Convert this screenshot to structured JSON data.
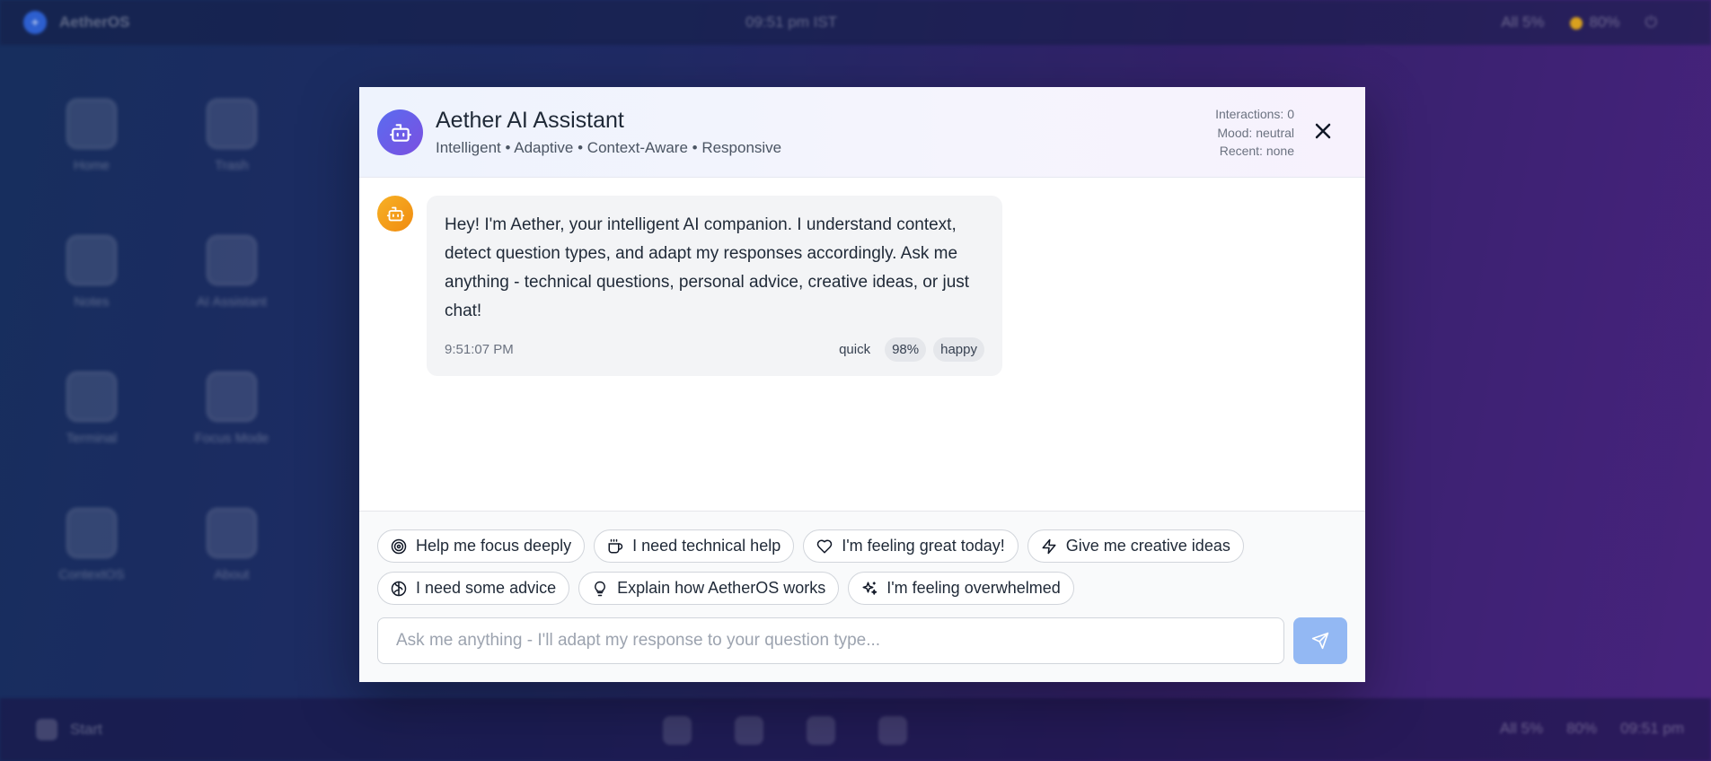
{
  "desktop": {
    "brand": "AetherOS",
    "clock": "09:51 pm IST",
    "status": {
      "network": "All 5%",
      "battery": "80%"
    },
    "icons": [
      {
        "label": "Home"
      },
      {
        "label": "Trash"
      },
      {
        "label": "Notes"
      },
      {
        "label": "AI Assistant"
      },
      {
        "label": "Terminal"
      },
      {
        "label": "Focus Mode"
      },
      {
        "label": "ContextOS"
      },
      {
        "label": "About"
      }
    ],
    "taskbar": {
      "start_label": "Start",
      "tray_network": "All 5%",
      "tray_battery": "80%",
      "tray_clock": "09:51 pm"
    }
  },
  "assistant": {
    "title": "Aether AI Assistant",
    "subtitle": "Intelligent • Adaptive • Context-Aware • Responsive",
    "stats": {
      "interactions": "Interactions: 0",
      "mood": "Mood: neutral",
      "recent": "Recent: none"
    },
    "close_icon": "close-icon"
  },
  "messages": [
    {
      "text": "Hey! I'm Aether, your intelligent AI companion. I understand context, detect question types, and adapt my responses accordingly. Ask me anything - technical questions, personal advice, creative ideas, or just chat!",
      "time": "9:51:07 PM",
      "tags": {
        "speed": "quick",
        "confidence": "98%",
        "mood": "happy"
      }
    }
  ],
  "quick_prompts": [
    {
      "label": "Help me focus deeply",
      "icon": "target-icon"
    },
    {
      "label": "I need technical help",
      "icon": "coffee-icon"
    },
    {
      "label": "I'm feeling great today!",
      "icon": "heart-icon"
    },
    {
      "label": "Give me creative ideas",
      "icon": "lightning-icon"
    },
    {
      "label": "I need some advice",
      "icon": "brain-icon"
    },
    {
      "label": "Explain how AetherOS works",
      "icon": "lightbulb-icon"
    },
    {
      "label": "I'm feeling overwhelmed",
      "icon": "sparkles-icon"
    }
  ],
  "composer": {
    "placeholder": "Ask me anything - I'll adapt my response to your question type...",
    "value": "",
    "send_icon": "send-icon"
  },
  "colors": {
    "assistant_avatar": "#5a6cf0",
    "bot_avatar": "#f7b125",
    "send_button": "#93b8f3"
  }
}
